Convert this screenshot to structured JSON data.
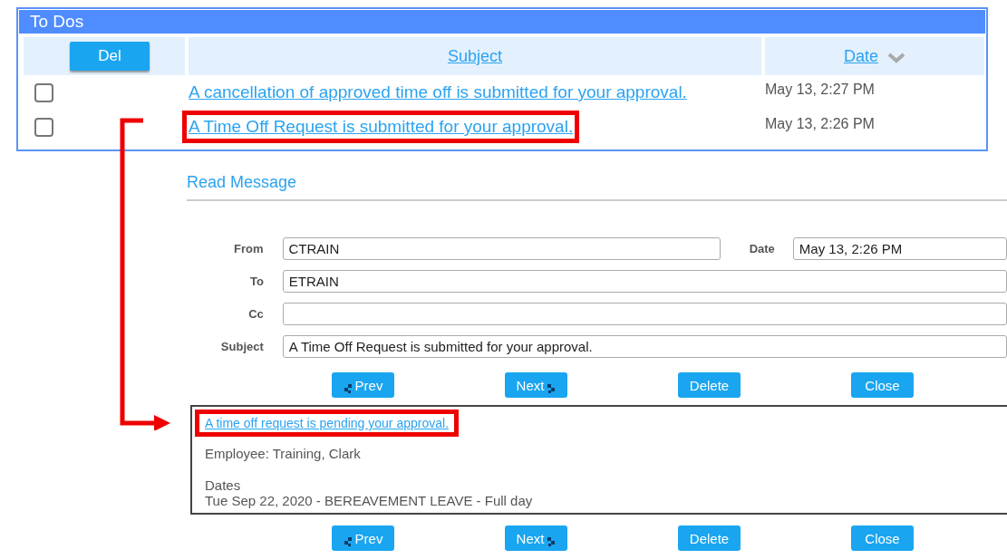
{
  "todos": {
    "title": "To Dos",
    "delete_button": "Del",
    "columns": [
      {
        "label": "Subject",
        "sorted": false
      },
      {
        "label": "Date",
        "sorted": true
      }
    ],
    "rows": [
      {
        "checked": false,
        "subject": "A cancellation of approved time off is submitted for your approval.",
        "date": "May 13, 2:27 PM",
        "highlighted": false
      },
      {
        "checked": false,
        "subject": "A Time Off Request is submitted for your approval.",
        "date": "May 13, 2:26 PM",
        "highlighted": true
      }
    ]
  },
  "read_message": {
    "title": "Read Message",
    "fields": [
      {
        "label": "From",
        "value": "CTRAIN"
      },
      {
        "label": "Date",
        "value": "May 13, 2:26 PM"
      },
      {
        "label": "To",
        "value": "ETRAIN"
      },
      {
        "label": "Cc"
      },
      {
        "label": "Subject",
        "value": "A Time Off Request is submitted for your approval."
      }
    ],
    "top_buttons": [
      {
        "kind": "prev",
        "label": "Prev"
      },
      {
        "kind": "next",
        "label": "Next"
      },
      {
        "kind": "plain",
        "label": "Delete"
      },
      {
        "kind": "plain",
        "label": "Close"
      }
    ],
    "body": {
      "link": "A time off request is pending your approval.",
      "link_highlighted": true,
      "employee": "Employee: Training, Clark",
      "dates_heading": "Dates",
      "dates_line": "Tue Sep 22, 2020 - BEREAVEMENT LEAVE - Full day"
    },
    "bottom_buttons": [
      {
        "kind": "prev",
        "label": "Prev"
      },
      {
        "kind": "next",
        "label": "Next"
      },
      {
        "kind": "plain",
        "label": "Delete"
      },
      {
        "kind": "plain",
        "label": "Close"
      }
    ]
  },
  "annotation_arrow": true
}
